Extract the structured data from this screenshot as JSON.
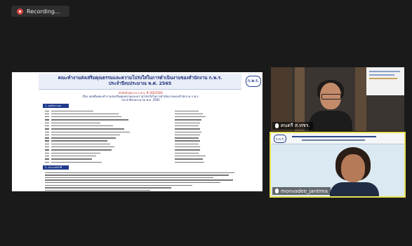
{
  "recording": {
    "label": "Recording...",
    "icon": "record-icon"
  },
  "shared_screen": {
    "title_line1": "คณะทำงานส่งเสริมคุณธรรมและความโปร่งใสในการดำเนินงานของสำนักงาน ก.พ.ร.",
    "title_line2": "ประจำปีงบประมาณ พ.ศ. 2565",
    "logo_text": "ก.พ.ร.",
    "order_line": "คำสั่งสำนักงาน ก.พ.ร. ที่ 165/2564",
    "subject_line1": "เรื่อง แต่งตั้งคณะทำงานส่งเสริมคุณธรรมและความโปร่งใสในการดำเนินงานของสำนักงาน ก.พ.ร.",
    "subject_line2": "ประจำปีงบประมาณ พ.ศ. 2565",
    "section1_label": "1. องค์ประกอบ",
    "section2_label": "2. อำนาจหน้าที่"
  },
  "participants": [
    {
      "name": "ดนตรี ส.ทชร.",
      "mic": "mic-icon"
    },
    {
      "name": "monvadee_jantima",
      "mic": "mic-icon"
    }
  ],
  "colors": {
    "background": "#1a1a1a",
    "active_speaker_border": "#e9df52",
    "slide_title": "#1f2f7a",
    "slide_accent_red": "#c21f1f",
    "record": "#d64545"
  }
}
